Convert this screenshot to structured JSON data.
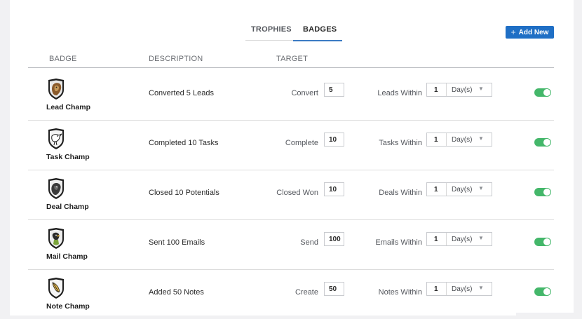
{
  "tabs": [
    {
      "label": "TROPHIES",
      "active": false
    },
    {
      "label": "BADGES",
      "active": true
    }
  ],
  "add_button": {
    "label": "Add New",
    "icon": "plus-icon",
    "color": "#1f6fc5"
  },
  "columns": {
    "badge": "BADGE",
    "description": "DESCRIPTION",
    "target": "TARGET"
  },
  "accent": {
    "tab_underline": "#3b7bc4",
    "toggle_on": "#44b76a"
  },
  "badges": [
    {
      "name": "Lead Champ",
      "icon": "lion-shield-icon",
      "description": "Converted 5 Leads",
      "verb": "Convert",
      "count": "5",
      "within": "Leads Within",
      "period_value": "1",
      "period_unit": "Day(s)",
      "enabled": true
    },
    {
      "name": "Task Champ",
      "icon": "stork-shield-icon",
      "description": "Completed 10 Tasks",
      "verb": "Complete",
      "count": "10",
      "within": "Tasks Within",
      "period_value": "1",
      "period_unit": "Day(s)",
      "enabled": true
    },
    {
      "name": "Deal Champ",
      "icon": "panther-shield-icon",
      "description": "Closed 10 Potentials",
      "verb": "Closed Won",
      "count": "10",
      "within": "Deals Within",
      "period_value": "1",
      "period_unit": "Day(s)",
      "enabled": true
    },
    {
      "name": "Mail Champ",
      "icon": "parrot-shield-icon",
      "description": "Sent 100 Emails",
      "verb": "Send",
      "count": "100",
      "within": "Emails Within",
      "period_value": "1",
      "period_unit": "Day(s)",
      "enabled": true
    },
    {
      "name": "Note Champ",
      "icon": "quill-shield-icon",
      "description": "Added 50 Notes",
      "verb": "Create",
      "count": "50",
      "within": "Notes Within",
      "period_value": "1",
      "period_unit": "Day(s)",
      "enabled": true
    }
  ]
}
